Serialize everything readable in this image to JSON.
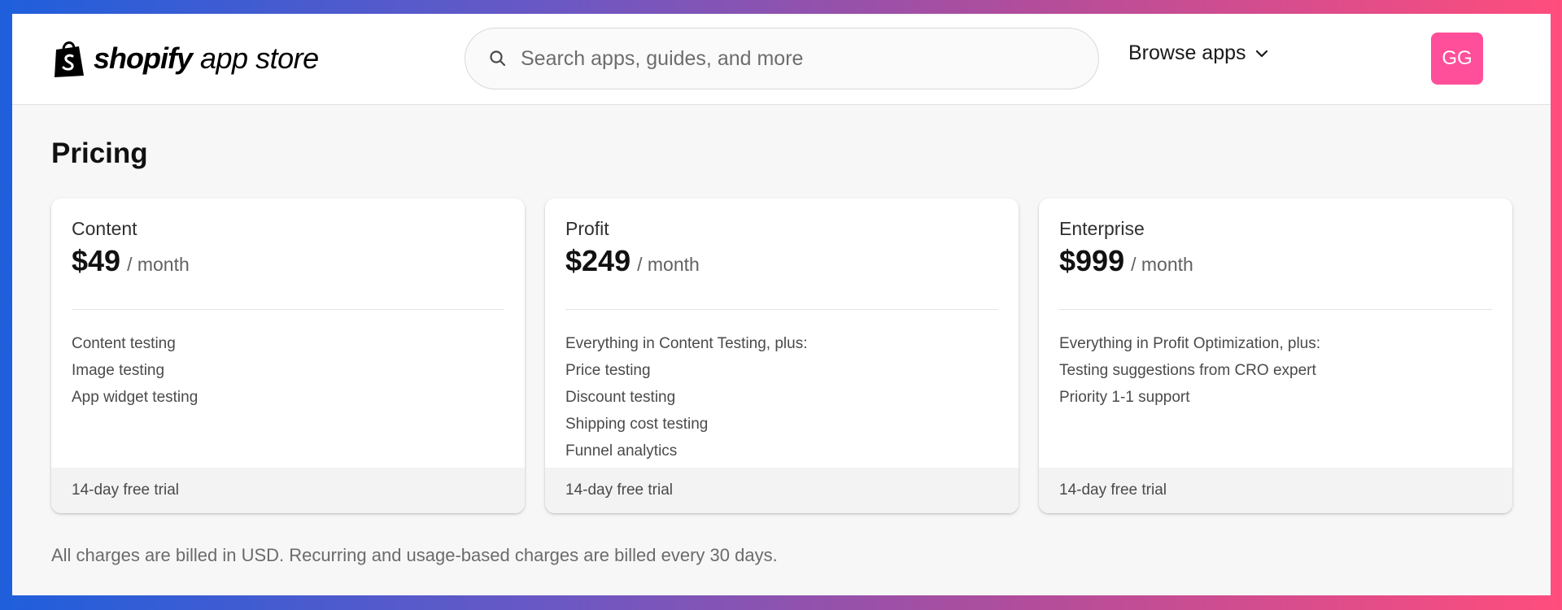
{
  "header": {
    "logo_word": "shopify",
    "logo_sub": "app store",
    "search_placeholder": "Search apps, guides, and more",
    "browse_label": "Browse apps",
    "avatar_initials": "GG"
  },
  "colors": {
    "avatar": "#ff4f9a",
    "background": "#f7f7f7",
    "card_footer": "#f3f3f3"
  },
  "page": {
    "title": "Pricing",
    "billing_note": "All charges are billed in USD. Recurring and usage-based charges are billed every 30 days."
  },
  "plans": [
    {
      "name": "Content",
      "price": "$49",
      "period": "/ month",
      "features": [
        "Content testing",
        "Image testing",
        "App widget testing"
      ],
      "trial": "14-day free trial"
    },
    {
      "name": "Profit",
      "price": "$249",
      "period": "/ month",
      "features": [
        "Everything in Content Testing, plus:",
        "Price testing",
        "Discount testing",
        "Shipping cost testing",
        "Funnel analytics"
      ],
      "trial": "14-day free trial"
    },
    {
      "name": "Enterprise",
      "price": "$999",
      "period": "/ month",
      "features": [
        "Everything in Profit Optimization, plus:",
        "Testing suggestions from CRO expert",
        "Priority 1-1 support"
      ],
      "trial": "14-day free trial"
    }
  ],
  "icons": {
    "search": "search-icon",
    "browse": "chevron-down-icon",
    "logo": "shopify-bag-icon"
  }
}
